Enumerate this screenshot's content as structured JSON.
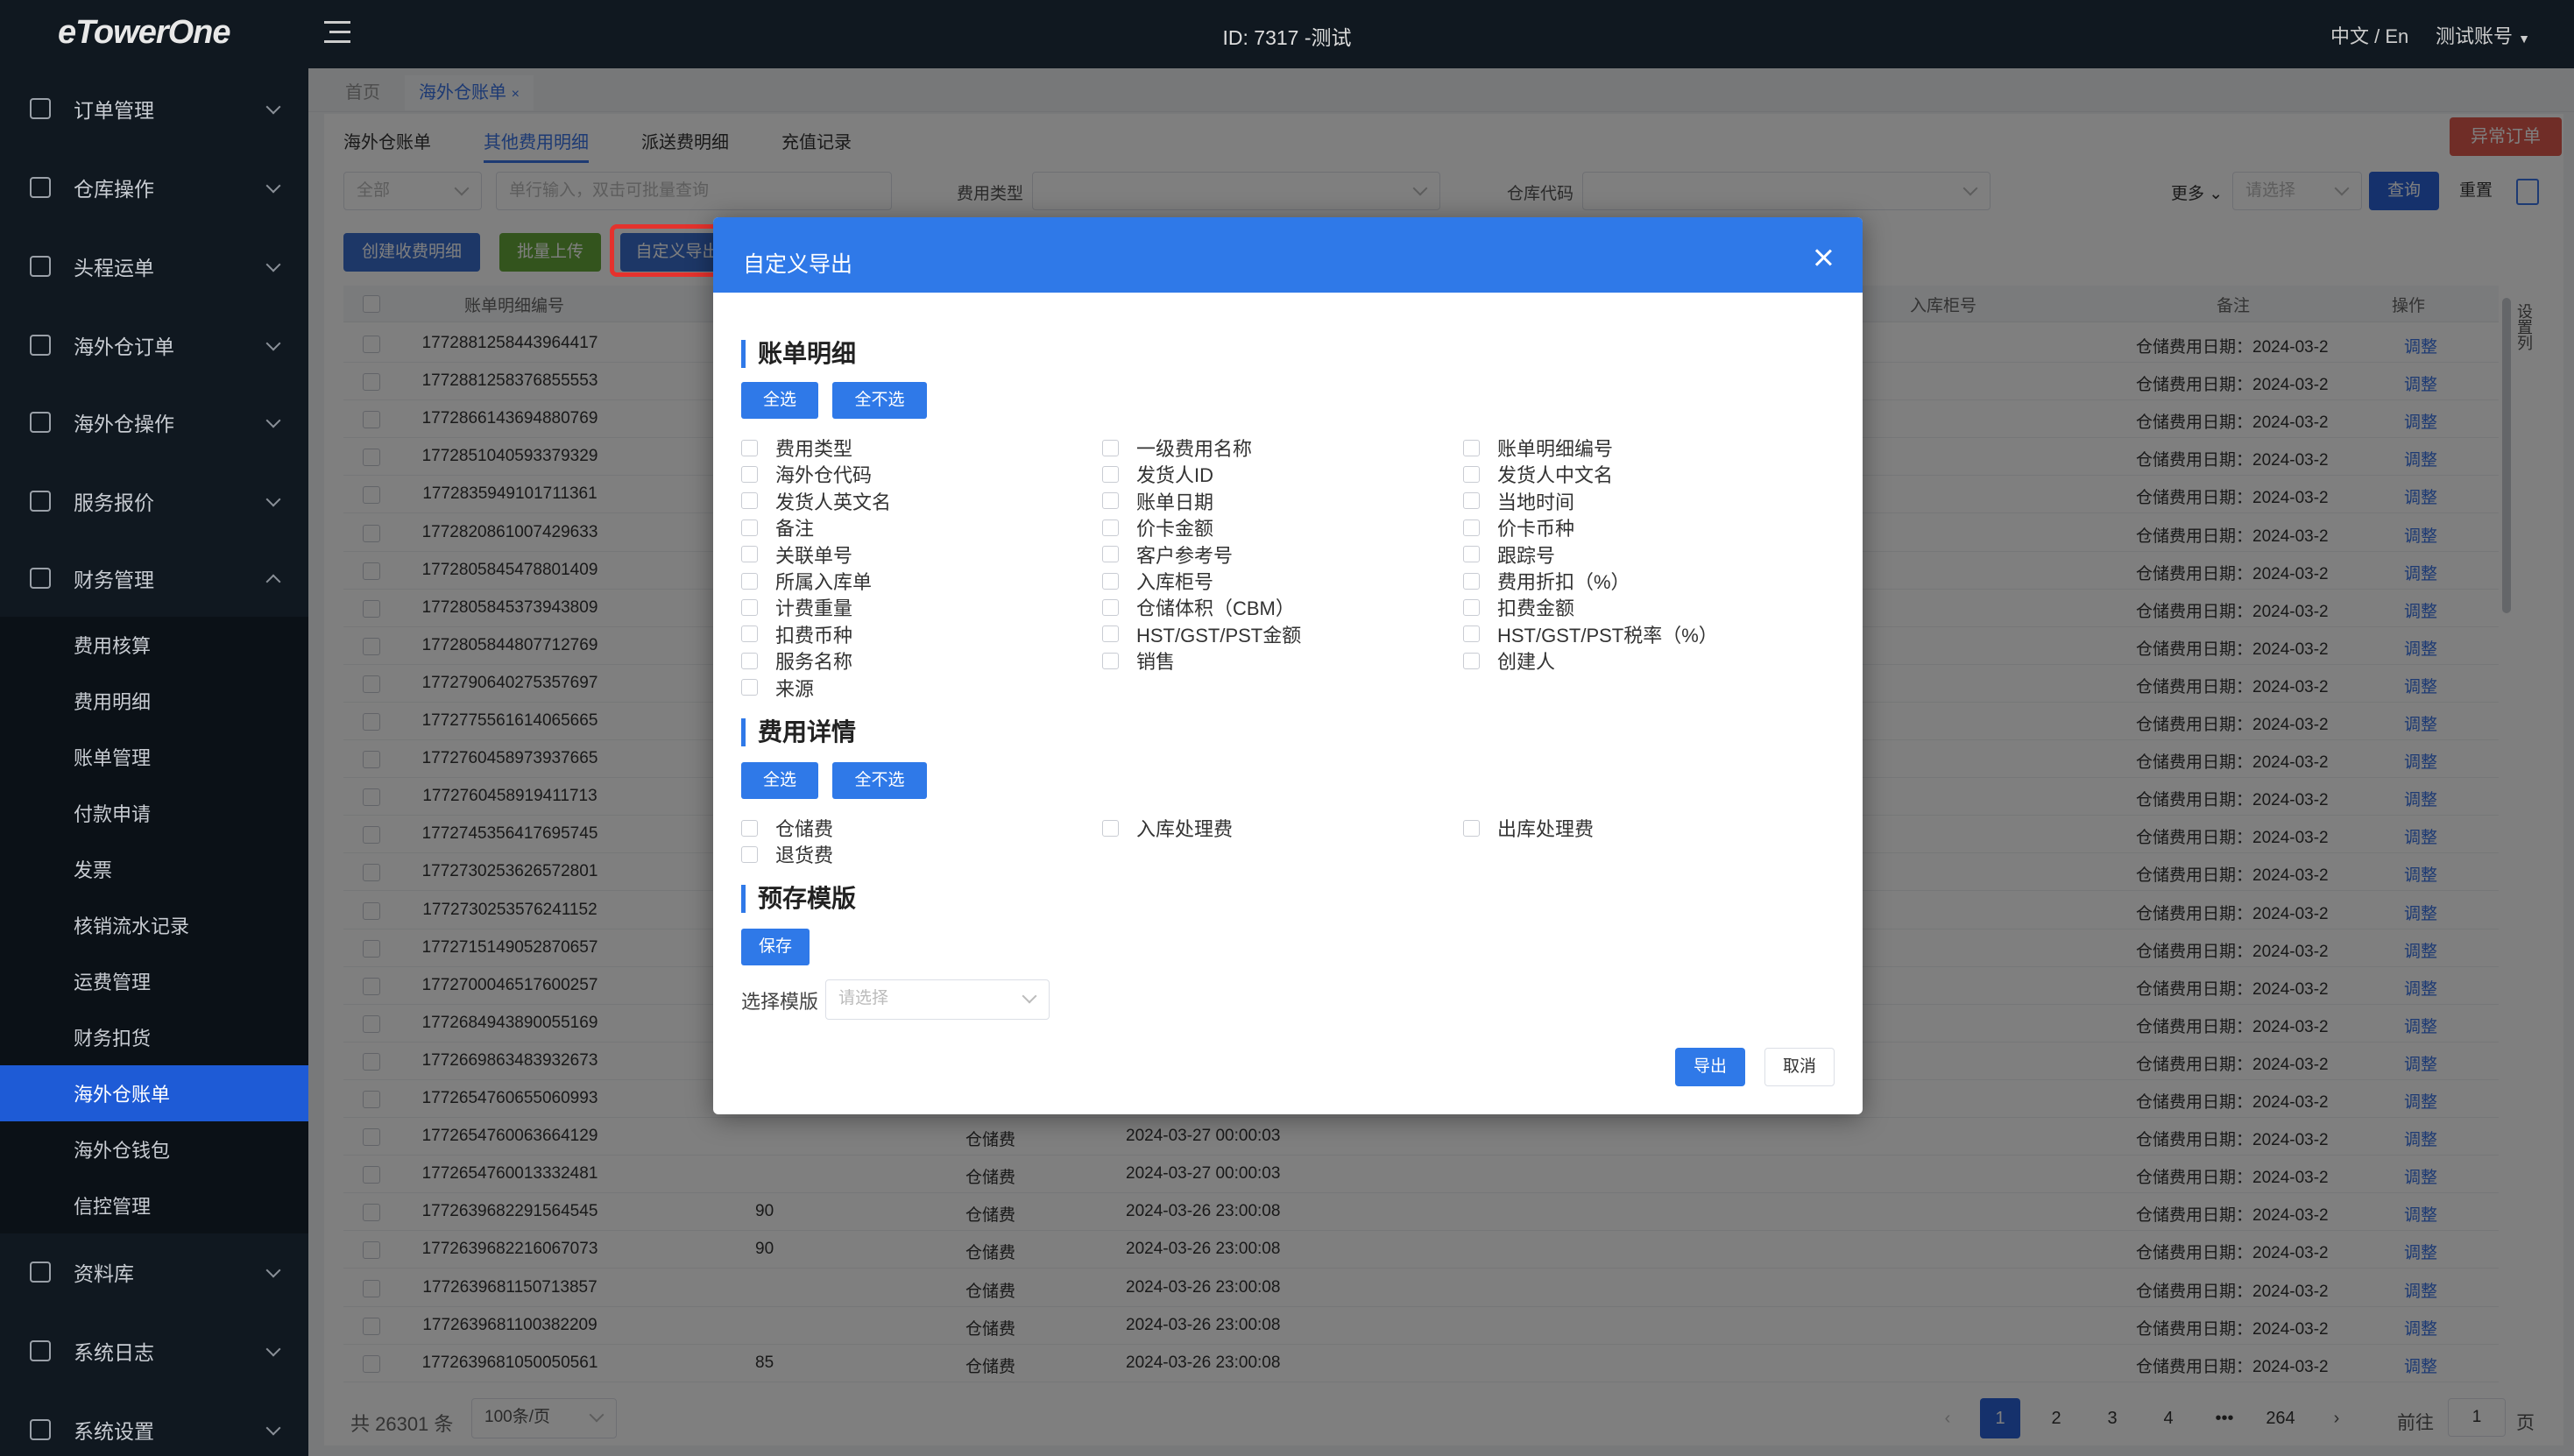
{
  "app": {
    "logo": "eTowerOne",
    "title": "ID: 7317 -测试",
    "language": "中文 / En",
    "account": "测试账号"
  },
  "sidebar": {
    "items": [
      {
        "label": "订单管理",
        "icon": "order-icon"
      },
      {
        "label": "仓库操作",
        "icon": "warehouse-icon"
      },
      {
        "label": "头程运单",
        "icon": "shipment-icon"
      },
      {
        "label": "海外仓订单",
        "icon": "overseas-order-icon"
      },
      {
        "label": "海外仓操作",
        "icon": "overseas-operation-icon"
      },
      {
        "label": "服务报价",
        "icon": "quote-icon"
      },
      {
        "label": "财务管理",
        "icon": "finance-icon"
      },
      {
        "label": "资料库",
        "icon": "database-icon"
      },
      {
        "label": "系统日志",
        "icon": "log-icon"
      },
      {
        "label": "系统设置",
        "icon": "settings-icon"
      }
    ],
    "finance_sub": [
      "费用核算",
      "费用明细",
      "账单管理",
      "付款申请",
      "发票",
      "核销流水记录",
      "运费管理",
      "财务扣货",
      "海外仓账单",
      "海外仓钱包",
      "信控管理"
    ],
    "active_sub": "海外仓账单"
  },
  "page_tabs": [
    "首页",
    "海外仓账单"
  ],
  "sub_tabs": [
    "海外仓账单",
    "其他费用明细",
    "派送费明细",
    "充值记录"
  ],
  "filters": {
    "scope": "全部",
    "search_placeholder": "单行输入，双击可批量查询",
    "fee_type_label": "费用类型",
    "warehouse_code_label": "仓库代码",
    "more": "更多",
    "more_placeholder": "请选择",
    "query": "查询",
    "reset": "重置",
    "anomaly": "异常订单"
  },
  "toolbar": {
    "create": "创建收费明细",
    "bulk_upload": "批量上传",
    "custom_export": "自定义导出"
  },
  "table": {
    "headers": {
      "id": "账单明细编号",
      "container": "入库柜号",
      "note": "备注",
      "op": "操作"
    },
    "rows": [
      {
        "id": "1772881258443964417",
        "amount": "",
        "type": "",
        "date": "",
        "note": "仓储费用日期：2024-03-2",
        "op": "调整"
      },
      {
        "id": "1772881258376855553",
        "amount": "",
        "type": "",
        "date": "",
        "note": "仓储费用日期：2024-03-2",
        "op": "调整"
      },
      {
        "id": "1772866143694880769",
        "amount": "",
        "type": "",
        "date": "",
        "note": "仓储费用日期：2024-03-2",
        "op": "调整"
      },
      {
        "id": "1772851040593379329",
        "amount": "",
        "type": "",
        "date": "",
        "note": "仓储费用日期：2024-03-2",
        "op": "调整"
      },
      {
        "id": "1772835949101711361",
        "amount": "",
        "type": "",
        "date": "",
        "note": "仓储费用日期：2024-03-2",
        "op": "调整"
      },
      {
        "id": "1772820861007429633",
        "amount": "",
        "type": "",
        "date": "",
        "note": "仓储费用日期：2024-03-2",
        "op": "调整"
      },
      {
        "id": "1772805845478801409",
        "amount": "",
        "type": "",
        "date": "",
        "note": "仓储费用日期：2024-03-2",
        "op": "调整"
      },
      {
        "id": "1772805845373943809",
        "amount": "",
        "type": "",
        "date": "",
        "note": "仓储费用日期：2024-03-2",
        "op": "调整"
      },
      {
        "id": "1772805844807712769",
        "amount": "",
        "type": "",
        "date": "",
        "note": "仓储费用日期：2024-03-2",
        "op": "调整"
      },
      {
        "id": "1772790640275357697",
        "amount": "",
        "type": "",
        "date": "",
        "note": "仓储费用日期：2024-03-2",
        "op": "调整"
      },
      {
        "id": "1772775561614065665",
        "amount": "",
        "type": "",
        "date": "",
        "note": "仓储费用日期：2024-03-2",
        "op": "调整"
      },
      {
        "id": "1772760458973937665",
        "amount": "",
        "type": "",
        "date": "",
        "note": "仓储费用日期：2024-03-2",
        "op": "调整"
      },
      {
        "id": "1772760458919411713",
        "amount": "",
        "type": "",
        "date": "",
        "note": "仓储费用日期：2024-03-2",
        "op": "调整"
      },
      {
        "id": "1772745356417695745",
        "amount": "",
        "type": "",
        "date": "",
        "note": "仓储费用日期：2024-03-2",
        "op": "调整"
      },
      {
        "id": "1772730253626572801",
        "amount": "",
        "type": "",
        "date": "",
        "note": "仓储费用日期：2024-03-2",
        "op": "调整"
      },
      {
        "id": "1772730253576241152",
        "amount": "",
        "type": "",
        "date": "",
        "note": "仓储费用日期：2024-03-2",
        "op": "调整"
      },
      {
        "id": "1772715149052870657",
        "amount": "",
        "type": "",
        "date": "",
        "note": "仓储费用日期：2024-03-2",
        "op": "调整"
      },
      {
        "id": "1772700046517600257",
        "amount": "",
        "type": "",
        "date": "",
        "note": "仓储费用日期：2024-03-2",
        "op": "调整"
      },
      {
        "id": "1772684943890055169",
        "amount": "",
        "type": "",
        "date": "",
        "note": "仓储费用日期：2024-03-2",
        "op": "调整"
      },
      {
        "id": "1772669863483932673",
        "amount": "",
        "type": "",
        "date": "",
        "note": "仓储费用日期：2024-03-2",
        "op": "调整"
      },
      {
        "id": "1772654760655060993",
        "amount": "",
        "type": "",
        "date": "",
        "note": "仓储费用日期：2024-03-2",
        "op": "调整"
      },
      {
        "id": "1772654760063664129",
        "amount": "",
        "type": "仓储费",
        "date": "2024-03-27 00:00:03",
        "note": "仓储费用日期：2024-03-2",
        "op": "调整"
      },
      {
        "id": "1772654760013332481",
        "amount": "",
        "type": "仓储费",
        "date": "2024-03-27 00:00:03",
        "note": "仓储费用日期：2024-03-2",
        "op": "调整"
      },
      {
        "id": "1772639682291564545",
        "amount": "90",
        "type": "仓储费",
        "date": "2024-03-26 23:00:08",
        "note": "仓储费用日期：2024-03-2",
        "op": "调整"
      },
      {
        "id": "1772639682216067073",
        "amount": "90",
        "type": "仓储费",
        "date": "2024-03-26 23:00:08",
        "note": "仓储费用日期：2024-03-2",
        "op": "调整"
      },
      {
        "id": "1772639681150713857",
        "amount": "",
        "type": "仓储费",
        "date": "2024-03-26 23:00:08",
        "note": "仓储费用日期：2024-03-2",
        "op": "调整"
      },
      {
        "id": "1772639681100382209",
        "amount": "",
        "type": "仓储费",
        "date": "2024-03-26 23:00:08",
        "note": "仓储费用日期：2024-03-2",
        "op": "调整"
      },
      {
        "id": "1772639681050050561",
        "amount": "85",
        "type": "仓储费",
        "date": "2024-03-26 23:00:08",
        "note": "仓储费用日期：2024-03-2",
        "op": "调整"
      }
    ],
    "column_settings": "设置列"
  },
  "pagination": {
    "total": "共 26301 条",
    "page_size": "100条/页",
    "pages": [
      "1",
      "2",
      "3",
      "4",
      "•••",
      "264"
    ],
    "goto_prefix": "前往",
    "goto_value": "1",
    "goto_suffix": "页"
  },
  "modal": {
    "title": "自定义导出",
    "sections": [
      {
        "title": "账单明细",
        "select_all": "全选",
        "select_none": "全不选",
        "options": [
          "费用类型",
          "一级费用名称",
          "账单明细编号",
          "海外仓代码",
          "发货人ID",
          "发货人中文名",
          "发货人英文名",
          "账单日期",
          "当地时间",
          "备注",
          "价卡金额",
          "价卡币种",
          "关联单号",
          "客户参考号",
          "跟踪号",
          "所属入库单",
          "入库柜号",
          "费用折扣（%）",
          "计费重量",
          "仓储体积（CBM）",
          "扣费金额",
          "扣费币种",
          "HST/GST/PST金额",
          "HST/GST/PST税率（%）",
          "服务名称",
          "销售",
          "创建人",
          "来源"
        ]
      },
      {
        "title": "费用详情",
        "select_all": "全选",
        "select_none": "全不选",
        "options": [
          "仓储费",
          "入库处理费",
          "出库处理费",
          "退货费"
        ]
      }
    ],
    "template_section": "预存模版",
    "save": "保存",
    "select_template_label": "选择模版",
    "select_template_placeholder": "请选择",
    "export": "导出",
    "cancel": "取消"
  }
}
